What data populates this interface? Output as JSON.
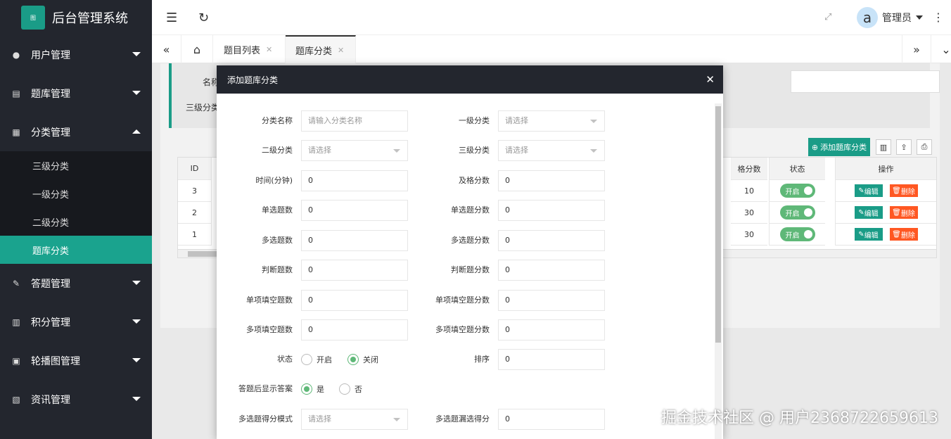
{
  "app": {
    "title": "后台管理系统",
    "logo_text": "图"
  },
  "sidebar": {
    "menus": [
      {
        "label": "用户管理",
        "icon": "users-icon"
      },
      {
        "label": "题库管理",
        "icon": "book-icon"
      },
      {
        "label": "分类管理",
        "icon": "grid-icon",
        "expanded": true
      },
      {
        "label": "答题管理",
        "icon": "pencil-icon"
      },
      {
        "label": "积分管理",
        "icon": "calendar-icon"
      },
      {
        "label": "轮播图管理",
        "icon": "image-icon"
      },
      {
        "label": "资讯管理",
        "icon": "news-icon"
      }
    ],
    "submenu": [
      "三级分类",
      "一级分类",
      "二级分类",
      "题库分类"
    ]
  },
  "header": {
    "user": "管理员",
    "avatar_letter": "a"
  },
  "tabs": [
    {
      "label": "题目列表"
    },
    {
      "label": "题库分类"
    }
  ],
  "search": {
    "label_name": "名称",
    "label_l3": "三级分类"
  },
  "toolbar": {
    "add_label": "添加题库分类"
  },
  "table": {
    "headers": {
      "id": "ID",
      "pass": "格分数",
      "status": "状态",
      "ops": "操作"
    },
    "rows": [
      {
        "id": "3",
        "pass": "10",
        "status": "开启"
      },
      {
        "id": "2",
        "pass": "30",
        "status": "开启"
      },
      {
        "id": "1",
        "pass": "30",
        "status": "开启"
      }
    ],
    "edit_label": "编辑",
    "delete_label": "删除"
  },
  "modal": {
    "title": "添加题库分类",
    "fields": {
      "name": {
        "label": "分类名称",
        "placeholder": "请输入分类名称"
      },
      "l1": {
        "label": "一级分类",
        "placeholder": "请选择"
      },
      "l2": {
        "label": "二级分类",
        "placeholder": "请选择"
      },
      "l3": {
        "label": "三级分类",
        "placeholder": "请选择"
      },
      "time": {
        "label": "时间(分钟)",
        "value": "0"
      },
      "pass": {
        "label": "及格分数",
        "value": "0"
      },
      "single_count": {
        "label": "单选题数",
        "value": "0"
      },
      "single_score": {
        "label": "单选题分数",
        "value": "0"
      },
      "multi_count": {
        "label": "多选题数",
        "value": "0"
      },
      "multi_score": {
        "label": "多选题分数",
        "value": "0"
      },
      "judge_count": {
        "label": "判断题数",
        "value": "0"
      },
      "judge_score": {
        "label": "判断题分数",
        "value": "0"
      },
      "sfill_count": {
        "label": "单项填空题数",
        "value": "0"
      },
      "sfill_score": {
        "label": "单项填空题分数",
        "value": "0"
      },
      "mfill_count": {
        "label": "多项填空题数",
        "value": "0"
      },
      "mfill_score": {
        "label": "多项填空题分数",
        "value": "0"
      },
      "status": {
        "label": "状态",
        "opt_on": "开启",
        "opt_off": "关闭",
        "selected": "关闭"
      },
      "sort": {
        "label": "排序",
        "value": "0"
      },
      "show_answer": {
        "label": "答题后显示答案",
        "opt_yes": "是",
        "opt_no": "否",
        "selected": "是"
      },
      "multi_mode": {
        "label": "多选题得分模式",
        "placeholder": "请选择"
      },
      "multi_miss": {
        "label": "多选题漏选得分",
        "value": "0"
      }
    }
  },
  "watermark": "掘金技术社区 @ 用户2368722659613"
}
